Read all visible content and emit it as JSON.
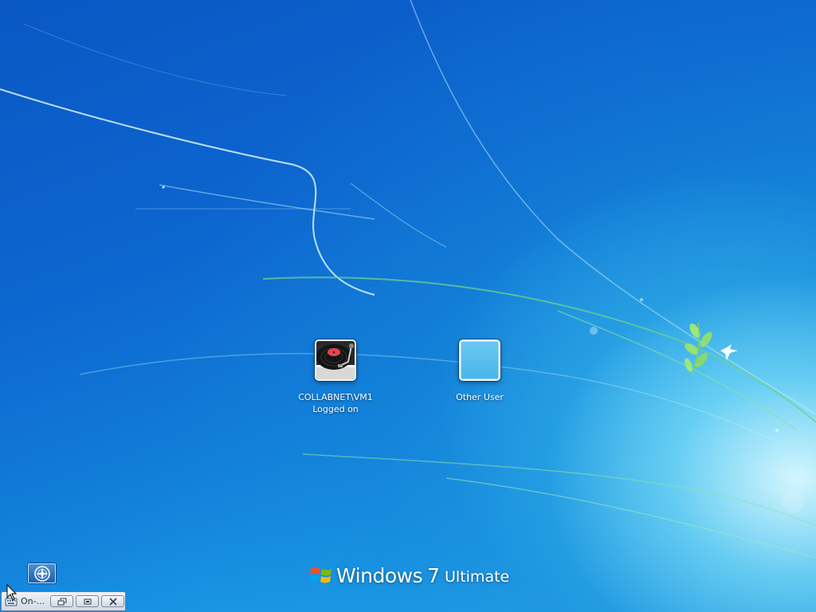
{
  "login_screen": {
    "users": [
      {
        "name": "COLLABNET\\VM1",
        "status": "Logged on",
        "avatar_icon": "turntable-icon"
      },
      {
        "name": "Other User",
        "avatar_icon": "blank-avatar-icon"
      }
    ]
  },
  "ease_of_access": {
    "icon": "ease-of-access-icon"
  },
  "branding": {
    "product": "Windows",
    "version": "7",
    "edition": "Ultimate",
    "logo_icon": "windows-flag-icon"
  },
  "on_screen_keyboard": {
    "title": "On-...",
    "icon": "keyboard-icon",
    "buttons": [
      "restore-icon",
      "minimize-icon",
      "close-icon"
    ]
  },
  "colors": {
    "background_dark": "#0a57c4",
    "background_light": "#34b6ef",
    "text": "#ffffff"
  }
}
